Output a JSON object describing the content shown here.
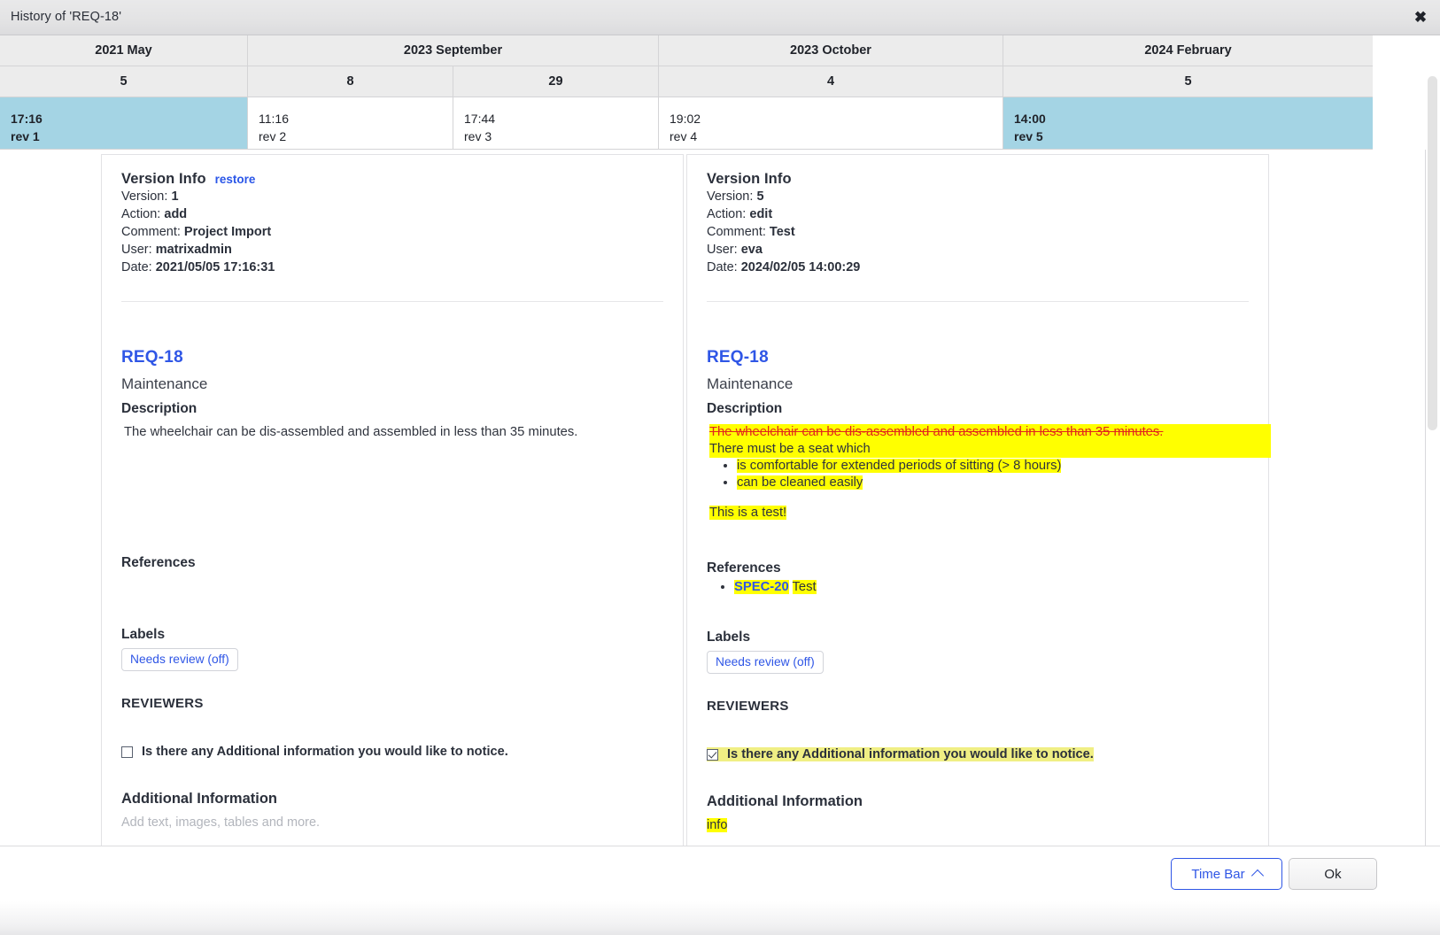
{
  "window": {
    "title": "History of 'REQ-18'",
    "close_icon": "close-icon"
  },
  "timebar": {
    "months": [
      {
        "label": "2021 May",
        "span": 1
      },
      {
        "label": "2023 September",
        "span": 2
      },
      {
        "label": "2023 October",
        "span": 1
      },
      {
        "label": "2024 February",
        "span": 1
      }
    ],
    "days": [
      "5",
      "8",
      "29",
      "4",
      "5"
    ],
    "revisions": [
      {
        "time": "17:16",
        "rev": "rev 1",
        "selected": true
      },
      {
        "time": "11:16",
        "rev": "rev 2",
        "selected": false
      },
      {
        "time": "17:44",
        "rev": "rev 3",
        "selected": false
      },
      {
        "time": "19:02",
        "rev": "rev 4",
        "selected": false
      },
      {
        "time": "14:00",
        "rev": "rev 5",
        "selected": true
      }
    ],
    "selected_color": "#a4d4e4"
  },
  "left_panel": {
    "version_info": {
      "heading": "Version Info",
      "restore_label": "restore",
      "version_label": "Version:",
      "version_value": "1",
      "action_label": "Action:",
      "action_value": "add",
      "comment_label": "Comment:",
      "comment_value": "Project Import",
      "user_label": "User:",
      "user_value": "matrixadmin",
      "date_label": "Date:",
      "date_value": "2021/05/05 17:16:31"
    },
    "item": {
      "id": "REQ-18",
      "title": "Maintenance",
      "description_heading": "Description",
      "description_text": "The wheelchair can be dis-assembled and assembled in less than 35 minutes.",
      "references_heading": "References",
      "references": [],
      "labels_heading": "Labels",
      "label_chip": "Needs review (off)",
      "reviewers_heading": "REVIEWERS",
      "reviewer_question": "Is there any Additional information you would like to notice.",
      "reviewer_checked": false,
      "additional_info_heading": "Additional Information",
      "additional_info_placeholder": "Add text, images, tables and more.",
      "additional_info_value": ""
    }
  },
  "right_panel": {
    "version_info": {
      "heading": "Version Info",
      "restore_label": "",
      "version_label": "Version:",
      "version_value": "5",
      "action_label": "Action:",
      "action_value": "edit",
      "comment_label": "Comment:",
      "comment_value": "Test",
      "user_label": "User:",
      "user_value": "eva",
      "date_label": "Date:",
      "date_value": "2024/02/05 14:00:29"
    },
    "item": {
      "id": "REQ-18",
      "title": "Maintenance",
      "description_heading": "Description",
      "description_deleted": "The wheelchair can be dis-assembled and assembled in less than 35 minutes.",
      "description_added_line": "There must be a seat which",
      "description_bullets": [
        "is comfortable for extended periods of sitting (> 8 hours)",
        "can be cleaned easily"
      ],
      "description_extra": "This is a test!",
      "references_heading": "References",
      "reference_id": "SPEC-20",
      "reference_title": "Test",
      "labels_heading": "Labels",
      "label_chip": "Needs review (off)",
      "reviewers_heading": "REVIEWERS",
      "reviewer_question": "Is there any Additional information you would like to notice.",
      "reviewer_checked": true,
      "additional_info_heading": "Additional Information",
      "additional_info_value": "info"
    }
  },
  "footer": {
    "timebar_button": "Time Bar",
    "timebar_chevron": "chevron-up-icon",
    "ok_button": "Ok"
  },
  "colors": {
    "highlight": "#ffff00",
    "highlight_muted": "#f0ef84",
    "deleted_text": "#e2241c",
    "link": "#2f56e6",
    "selected_rev": "#a4d4e4"
  }
}
